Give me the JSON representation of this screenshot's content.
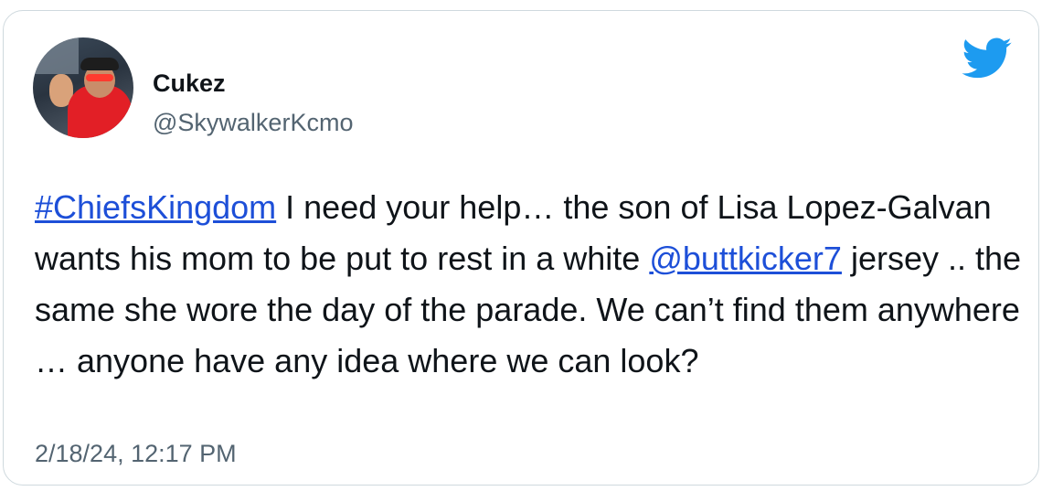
{
  "author": {
    "name": "Cukez",
    "handle": "@SkywalkerKcmo",
    "avatar": "profile-photo"
  },
  "tweet": {
    "hashtag": "#ChiefsKingdom",
    "text_part1": " I need your help… the son of Lisa Lopez-Galvan wants his mom to be put to rest in a white ",
    "mention": "@buttkicker7",
    "text_part2": " jersey .. the same she wore the day of the parade. We can’t find them anywhere … anyone have any idea where we can look?"
  },
  "timestamp": "2/18/24, 12:17 PM",
  "icons": {
    "brand": "twitter-bird-icon"
  },
  "colors": {
    "brand": "#1d9bf0",
    "link": "#1d4fd8",
    "text": "#0f1419",
    "secondary_text": "#536471",
    "border": "#cfd9de"
  }
}
